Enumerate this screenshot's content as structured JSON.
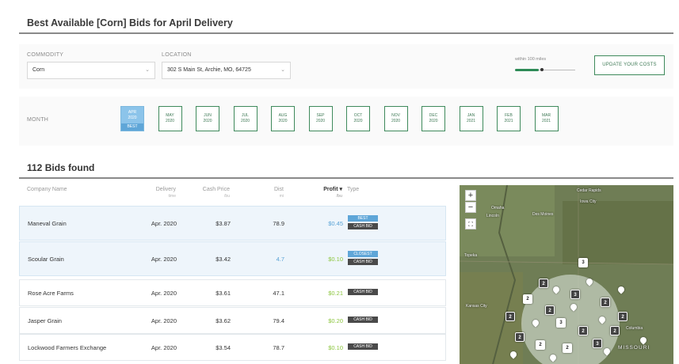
{
  "header": {
    "title": "Best Available [Corn] Bids for April Delivery"
  },
  "filters": {
    "commodity_label": "COMMODITY",
    "commodity_value": "Corn",
    "location_label": "LOCATION",
    "location_value": "302 S Main St, Archie, MO, 64725",
    "radius_text": "within 100 miles",
    "radius_fraction": 0.4,
    "update_button": "UPDATE YOUR COSTS"
  },
  "months": {
    "label": "MONTH",
    "best_badge": "BEST",
    "items": [
      {
        "mon": "APR",
        "year": "2020"
      },
      {
        "mon": "MAY",
        "year": "2020"
      },
      {
        "mon": "JUN",
        "year": "2020"
      },
      {
        "mon": "JUL",
        "year": "2020"
      },
      {
        "mon": "AUG",
        "year": "2020"
      },
      {
        "mon": "SEP",
        "year": "2020"
      },
      {
        "mon": "OCT",
        "year": "2020"
      },
      {
        "mon": "NOV",
        "year": "2020"
      },
      {
        "mon": "DEC",
        "year": "2020"
      },
      {
        "mon": "JAN",
        "year": "2021"
      },
      {
        "mon": "FEB",
        "year": "2021"
      },
      {
        "mon": "MAR",
        "year": "2021"
      }
    ]
  },
  "results": {
    "count_text": "112 Bids found",
    "columns": {
      "company": "Company Name",
      "delivery": "Delivery",
      "delivery_unit": "time",
      "cash": "Cash Price",
      "cash_unit": "/bu",
      "dist": "Dist",
      "dist_unit": "mi",
      "profit": "Profit ▾",
      "profit_unit": "/bu",
      "type": "Type"
    },
    "rows": [
      {
        "company": "Maneval Grain",
        "delivery": "Apr. 2020",
        "cash": "$3.87",
        "dist": "78.9",
        "profit": "$0.45",
        "tags": [
          "BEST",
          "CASH BID"
        ]
      },
      {
        "company": "Scoular Grain",
        "delivery": "Apr. 2020",
        "cash": "$3.42",
        "dist": "4.7",
        "profit": "$0.10",
        "tags": [
          "CLOSEST",
          "CASH BID"
        ]
      },
      {
        "company": "Rose Acre Farms",
        "delivery": "Apr. 2020",
        "cash": "$3.61",
        "dist": "47.1",
        "profit": "$0.21",
        "tags": [
          "CASH BID"
        ]
      },
      {
        "company": "Jasper Grain",
        "delivery": "Apr. 2020",
        "cash": "$3.62",
        "dist": "79.4",
        "profit": "$0.20",
        "tags": [
          "CASH BID"
        ]
      },
      {
        "company": "Lockwood Farmers Exchange",
        "delivery": "Apr. 2020",
        "cash": "$3.54",
        "dist": "78.7",
        "profit": "$0.10",
        "tags": [
          "CASH BID"
        ]
      }
    ]
  },
  "map": {
    "zoom_in": "+",
    "zoom_out": "−",
    "labels": [
      "Cedar Rapids",
      "Iowa City",
      "Omaha",
      "Lincoln",
      "Des Moines",
      "Kansas City",
      "Columbia",
      "MISSOURI",
      "Topeka"
    ],
    "markers": [
      "3",
      "2",
      "3",
      "2",
      "2",
      "2",
      "3",
      "2",
      "2",
      "2",
      "3",
      "2",
      "2",
      "2",
      "2"
    ]
  },
  "colors": {
    "accent_green": "#3f8a5c",
    "accent_blue": "#5fa6d8",
    "profit_green": "#8cc63f"
  }
}
